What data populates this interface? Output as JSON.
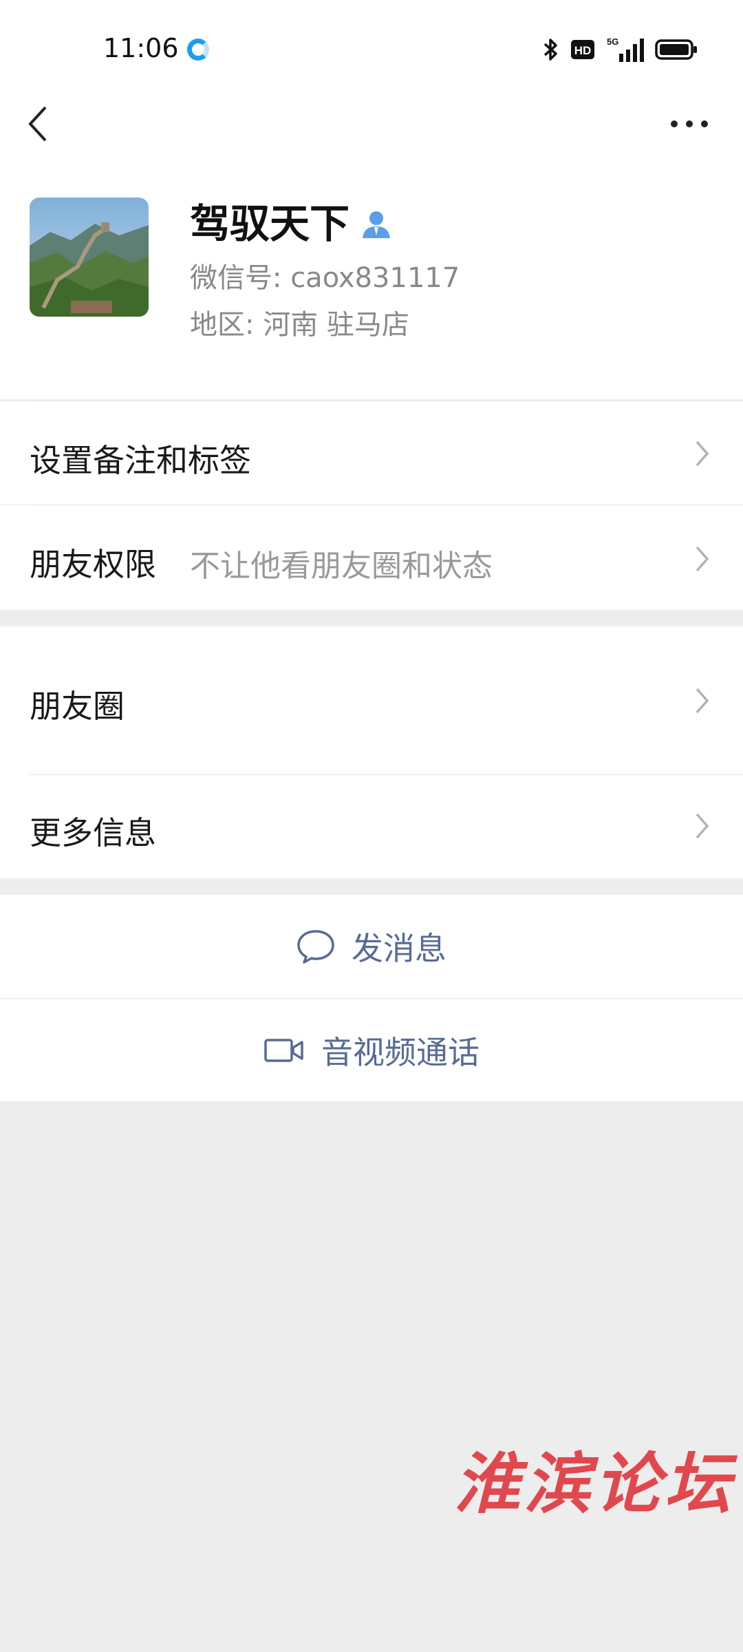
{
  "status_bar": {
    "time": "11:06",
    "network": "5G"
  },
  "profile": {
    "name": "驾驭天下",
    "wechat_id": "微信号: caox831117",
    "region": "地区: 河南  驻马店"
  },
  "menu": {
    "remark_label": "设置备注和标签",
    "permission_label": "朋友权限",
    "permission_value": "不让他看朋友圈和状态",
    "moments_label": "朋友圈",
    "more_info_label": "更多信息"
  },
  "actions": {
    "message_label": "发消息",
    "call_label": "音视频通话"
  },
  "watermark": "淮滨论坛",
  "colors": {
    "link": "#576b95",
    "background": "#ededed",
    "watermark": "#e0484e"
  }
}
